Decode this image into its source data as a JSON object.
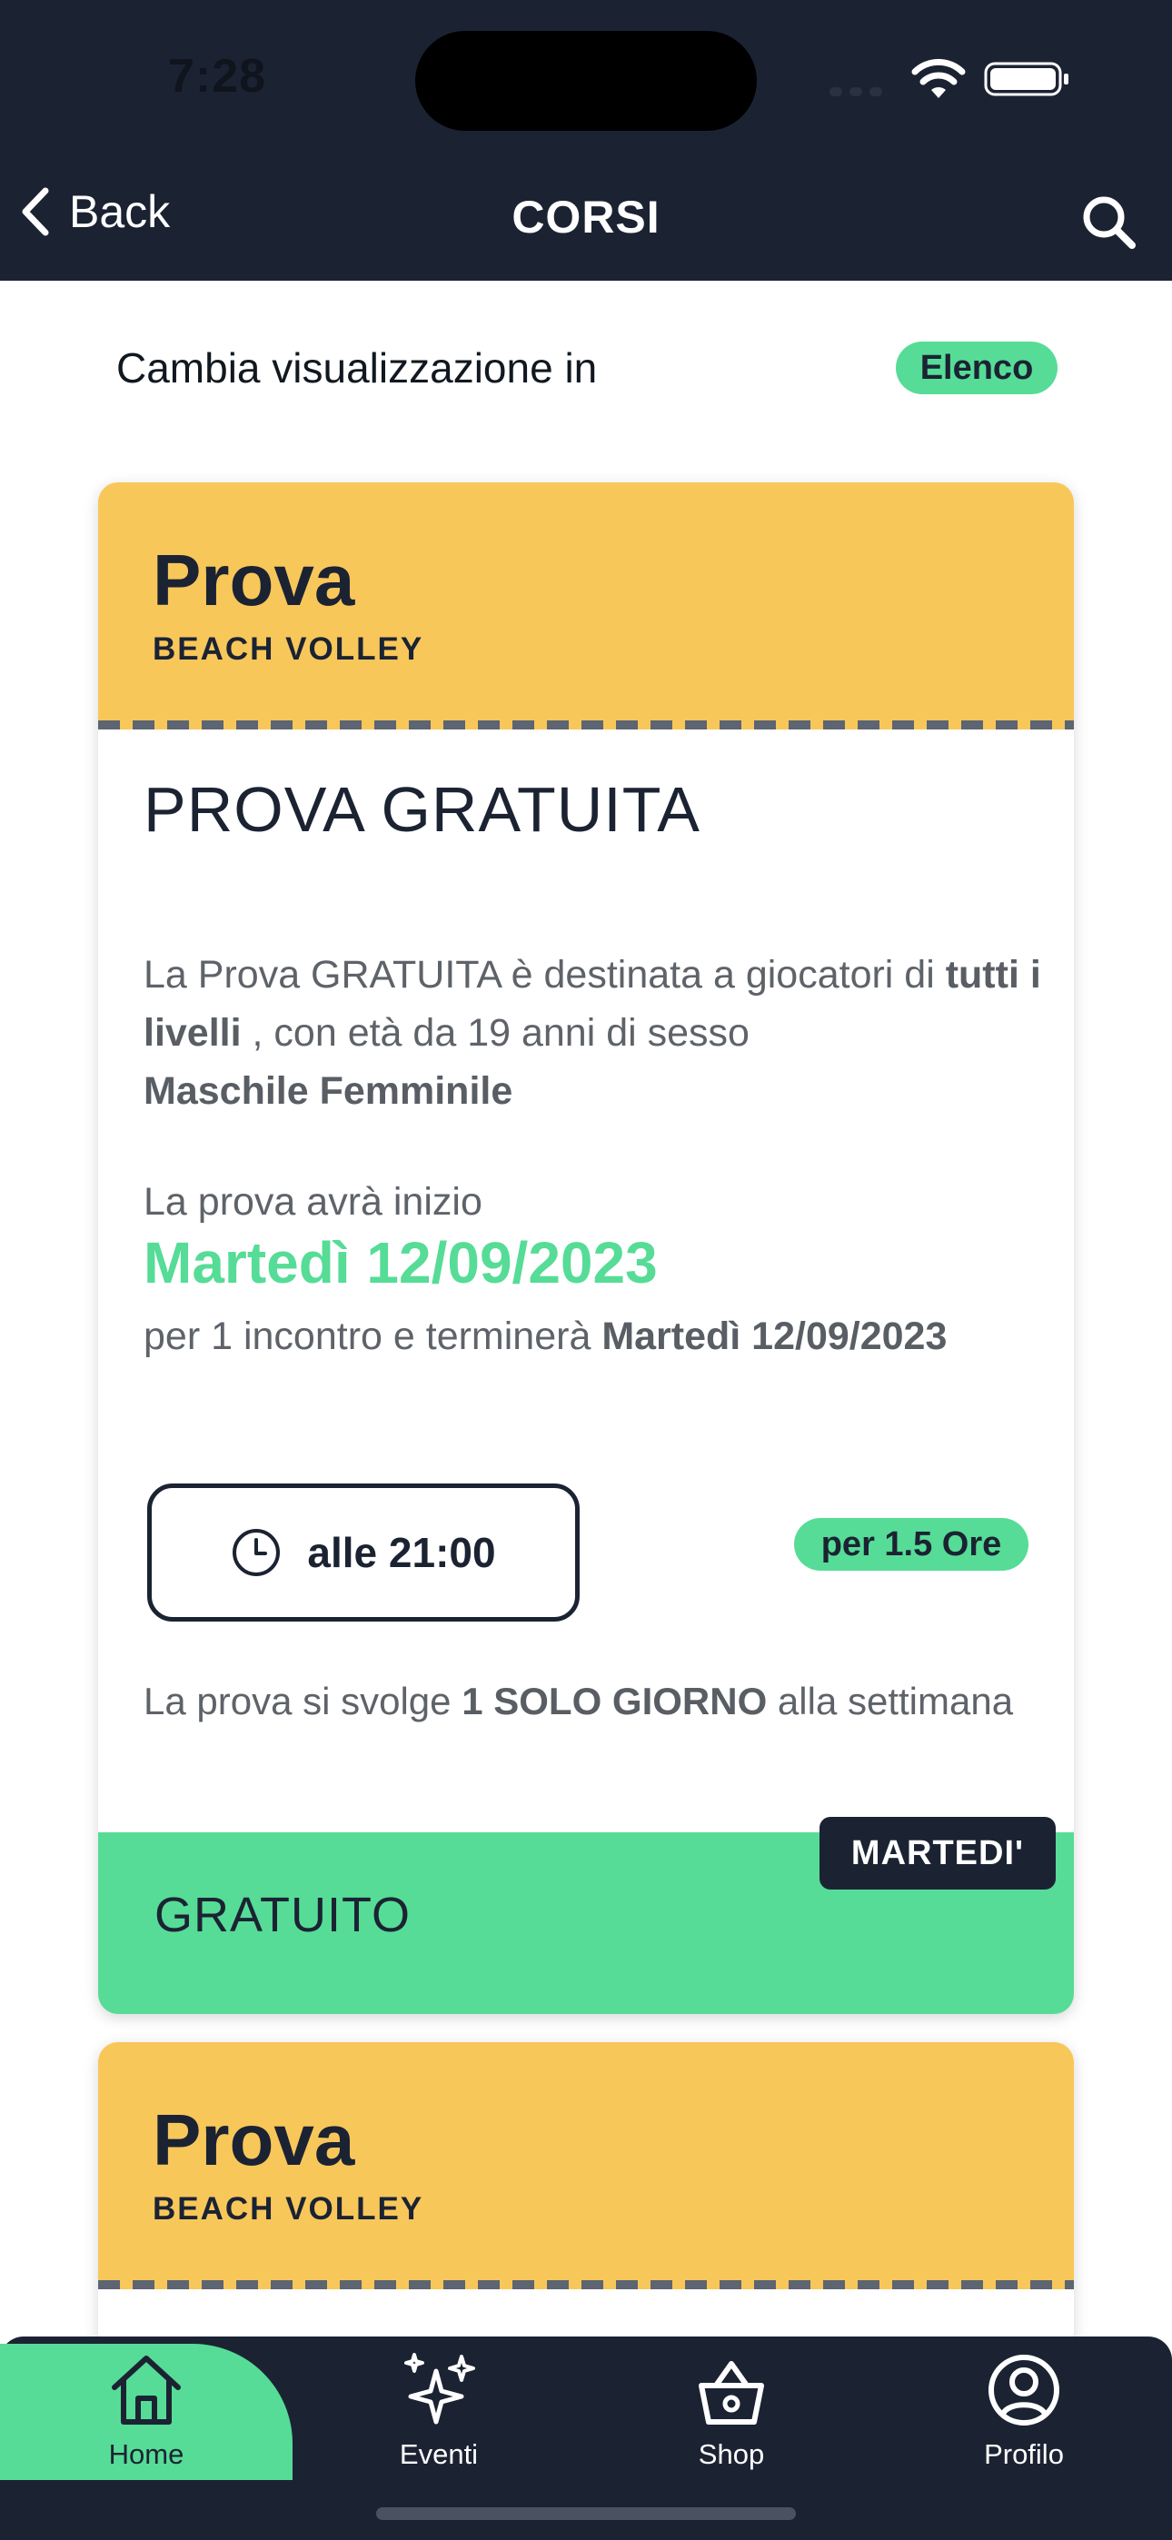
{
  "status_bar": {
    "time": "7:28"
  },
  "nav": {
    "back_label": "Back",
    "title": "CORSI",
    "back_icon": "chevron-left-icon",
    "search_icon": "search-icon"
  },
  "view_switch": {
    "label": "Cambia visualizzazione in",
    "option": "Elenco"
  },
  "cards": [
    {
      "kind": "Prova",
      "sport": "BEACH VOLLEY",
      "title": "PROVA GRATUITA",
      "desc_1": "La Prova GRATUITA è destinata a giocatori di ",
      "level": "tutti i livelli",
      "desc_2": " , con età da 19 anni di sesso ",
      "gender": "Maschile Femminile",
      "start_intro": "La prova avrà inizio",
      "start_date": "Martedì 12/09/2023",
      "end_1": " per 1 incontro e terminerà ",
      "end_date": "Martedì 12/09/2023",
      "time": "alle 21:00",
      "duration": "per 1.5 Ore",
      "days_1": "La prova si svolge ",
      "days_bold": "1 SOLO GIORNO",
      "days_2": " alla settimana",
      "price": "GRATUITO",
      "weekday": "MARTEDI'"
    },
    {
      "kind": "Prova",
      "sport": "BEACH VOLLEY"
    }
  ],
  "tabs": [
    {
      "label": "Home",
      "icon": "home-icon"
    },
    {
      "label": "Eventi",
      "icon": "sparkles-icon"
    },
    {
      "label": "Shop",
      "icon": "basket-icon"
    },
    {
      "label": "Profilo",
      "icon": "profile-icon"
    }
  ],
  "colors": {
    "navy": "#1b2333",
    "accent_green": "#56dc96",
    "card_yellow": "#f8c75a",
    "body_text": "#5e6369"
  }
}
